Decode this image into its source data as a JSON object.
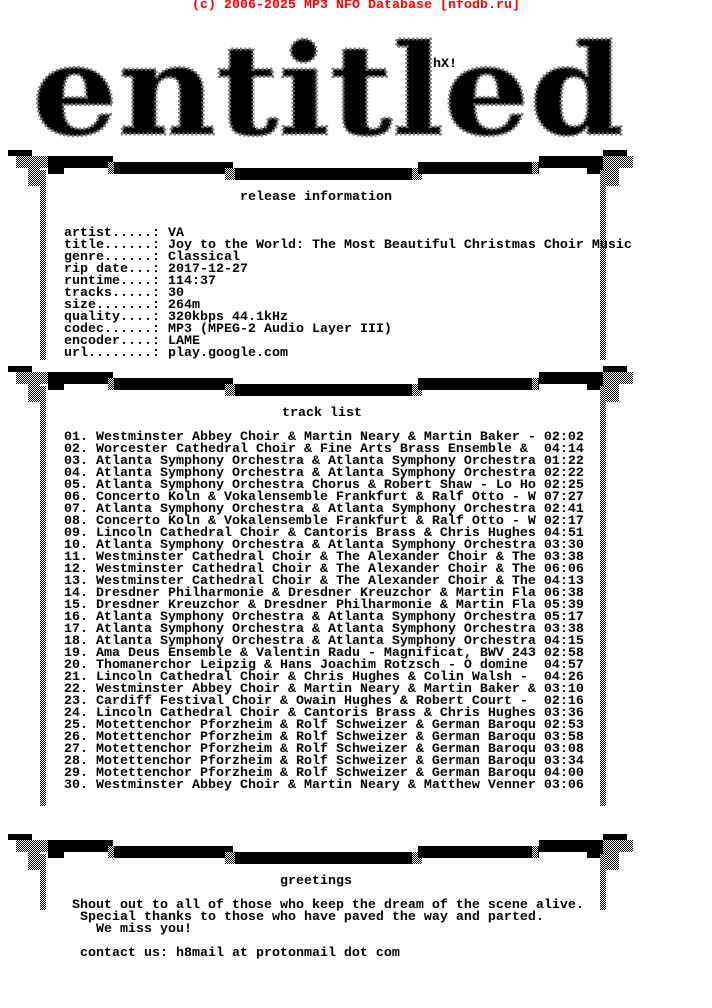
{
  "copyright": "(c) 2006-2025 MP3 NFO Database [nfodb.ru]",
  "logo": {
    "text": "entitled",
    "tag": "hX!"
  },
  "sections": {
    "release": "release information",
    "tracks": "track list",
    "greetings": "greetings"
  },
  "release_info": [
    {
      "key": "artist.....:",
      "value": "VA"
    },
    {
      "key": "title......:",
      "value": "Joy to the World: The Most Beautiful Christmas Choir Music"
    },
    {
      "key": "genre......:",
      "value": "Classical"
    },
    {
      "key": "rip date...:",
      "value": "2017-12-27"
    },
    {
      "key": "runtime....:",
      "value": "114:37"
    },
    {
      "key": "tracks.....:",
      "value": "30"
    },
    {
      "key": "size.......:",
      "value": "264m"
    },
    {
      "key": "quality....:",
      "value": "320kbps 44.1kHz"
    },
    {
      "key": "codec......:",
      "value": "MP3 (MPEG-2 Audio Layer III)"
    },
    {
      "key": "encoder....:",
      "value": "LAME"
    },
    {
      "key": "url........:",
      "value": "play.google.com"
    }
  ],
  "tracks": [
    {
      "n": "01.",
      "title": "Westminster Abbey Choir & Martin Neary & Martin Baker -",
      "time": "02:02"
    },
    {
      "n": "02.",
      "title": "Worcester Cathedral Choir & Fine Arts Brass Ensemble & ",
      "time": "04:14"
    },
    {
      "n": "03.",
      "title": "Atlanta Symphony Orchestra & Atlanta Symphony Orchestra",
      "time": "01:22"
    },
    {
      "n": "04.",
      "title": "Atlanta Symphony Orchestra & Atlanta Symphony Orchestra",
      "time": "02:22"
    },
    {
      "n": "05.",
      "title": "Atlanta Symphony Orchestra Chorus & Robert Shaw - Lo Ho",
      "time": "02:25"
    },
    {
      "n": "06.",
      "title": "Concerto Koln & Vokalensemble Frankfurt & Ralf Otto - W",
      "time": "07:27"
    },
    {
      "n": "07.",
      "title": "Atlanta Symphony Orchestra & Atlanta Symphony Orchestra",
      "time": "02:41"
    },
    {
      "n": "08.",
      "title": "Concerto Koln & Vokalensemble Frankfurt & Ralf Otto - W",
      "time": "02:17"
    },
    {
      "n": "09.",
      "title": "Lincoln Cathedral Choir & Cantoris Brass & Chris Hughes",
      "time": "04:51"
    },
    {
      "n": "10.",
      "title": "Atlanta Symphony Orchestra & Atlanta Symphony Orchestra",
      "time": "03:30"
    },
    {
      "n": "11.",
      "title": "Westminster Cathedral Choir & The Alexander Choir & The",
      "time": "03:38"
    },
    {
      "n": "12.",
      "title": "Westminster Cathedral Choir & The Alexander Choir & The",
      "time": "06:06"
    },
    {
      "n": "13.",
      "title": "Westminster Cathedral Choir & The Alexander Choir & The",
      "time": "04:13"
    },
    {
      "n": "14.",
      "title": "Dresdner Philharmonie & Dresdner Kreuzchor & Martin Fla",
      "time": "06:38"
    },
    {
      "n": "15.",
      "title": "Dresdner Kreuzchor & Dresdner Philharmonie & Martin Fla",
      "time": "05:39"
    },
    {
      "n": "16.",
      "title": "Atlanta Symphony Orchestra & Atlanta Symphony Orchestra",
      "time": "05:17"
    },
    {
      "n": "17.",
      "title": "Atlanta Symphony Orchestra & Atlanta Symphony Orchestra",
      "time": "03:38"
    },
    {
      "n": "18.",
      "title": "Atlanta Symphony Orchestra & Atlanta Symphony Orchestra",
      "time": "04:15"
    },
    {
      "n": "19.",
      "title": "Ama Deus Ensemble & Valentin Radu - Magnificat, BWV 243",
      "time": "02:58"
    },
    {
      "n": "20.",
      "title": "Thomanerchor Leipzig & Hans Joachim Rotzsch - O domine ",
      "time": "04:57"
    },
    {
      "n": "21.",
      "title": "Lincoln Cathedral Choir & Chris Hughes & Colin Walsh - ",
      "time": "04:26"
    },
    {
      "n": "22.",
      "title": "Westminster Abbey Choir & Martin Neary & Martin Baker &",
      "time": "03:10"
    },
    {
      "n": "23.",
      "title": "Cardiff Festival Choir & Owain Hughes & Robert Court - ",
      "time": "02:16"
    },
    {
      "n": "24.",
      "title": "Lincoln Cathedral Choir & Cantoris Brass & Chris Hughes",
      "time": "03:36"
    },
    {
      "n": "25.",
      "title": "Motettenchor Pforzheim & Rolf Schweizer & German Baroqu",
      "time": "02:53"
    },
    {
      "n": "26.",
      "title": "Motettenchor Pforzheim & Rolf Schweizer & German Baroqu",
      "time": "03:58"
    },
    {
      "n": "27.",
      "title": "Motettenchor Pforzheim & Rolf Schweizer & German Baroqu",
      "time": "03:08"
    },
    {
      "n": "28.",
      "title": "Motettenchor Pforzheim & Rolf Schweizer & German Baroqu",
      "time": "03:34"
    },
    {
      "n": "29.",
      "title": "Motettenchor Pforzheim & Rolf Schweizer & German Baroqu",
      "time": "04:00"
    },
    {
      "n": "30.",
      "title": "Westminster Abbey Choir & Martin Neary & Matthew Venner",
      "time": "03:06"
    }
  ],
  "greetings": [
    " Shout out to all of those who keep the dream of the scene alive.",
    "  Special thanks to those who have paved the way and parted.",
    "    We miss you!",
    "",
    "  contact us: h8mail at protonmail dot com"
  ],
  "colors": {
    "copyright": "#ff0000",
    "text": "#000000",
    "background": "#ffffff"
  }
}
